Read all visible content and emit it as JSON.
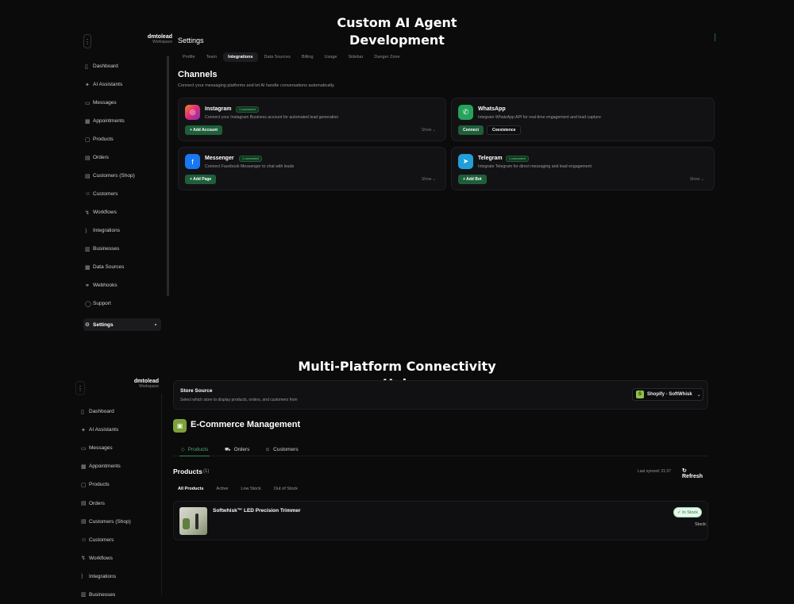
{
  "headline_top": {
    "line1": "Custom AI Agent",
    "line2": "Development"
  },
  "headline_bottom": {
    "line1": "Multi-Platform Connectivity",
    "line2": "Hub"
  },
  "panel1": {
    "workspace": {
      "name": "dmtolead",
      "sub": "Workspace"
    },
    "nav": [
      "Dashboard",
      "AI Assistants",
      "Messages",
      "Appointments",
      "Products",
      "Orders",
      "Customers (Shop)",
      "Customers",
      "Workflows",
      "Integrations",
      "Businesses",
      "Data Sources",
      "Webhooks",
      "Support"
    ],
    "active_nav": "Settings",
    "title": "Settings",
    "tabs": [
      "Profile",
      "Team",
      "Integrations",
      "Data Sources",
      "Billing",
      "Usage",
      "Sidebar",
      "Danger Zone"
    ],
    "active_tab": "Integrations",
    "channels_title": "Channels",
    "channels_desc": "Connect your messaging platforms and let AI handle conversations automatically.",
    "cards": [
      {
        "name": "Instagram",
        "badge": "1 connected",
        "desc": "Connect your Instagram Business account for automated lead generation",
        "button": "+  Add Account",
        "show": "Show ⌄",
        "color": "#d62976",
        "icon": "instagram-icon"
      },
      {
        "name": "WhatsApp",
        "badge": "",
        "desc": "Integrate WhatsApp API for real-time engagement and lead capture",
        "button": "Connect",
        "button2": "Coexistence",
        "show": "",
        "color": "#25a35a",
        "icon": "whatsapp-icon"
      },
      {
        "name": "Messenger",
        "badge": "1 connected",
        "desc": "Connect Facebook Messenger to chat with leads",
        "button": "+  Add Page",
        "show": "Show ⌄",
        "color": "#1877f2",
        "icon": "messenger-icon"
      },
      {
        "name": "Telegram",
        "badge": "1 connected",
        "desc": "Integrate Telegram for direct messaging and lead engagement",
        "button": "+  Add Bot",
        "show": "Show ⌄",
        "color": "#229ed9",
        "icon": "telegram-icon"
      }
    ]
  },
  "panel2": {
    "workspace": {
      "name": "dmtolead",
      "sub": "Workspace"
    },
    "nav": [
      "Dashboard",
      "AI Assistants",
      "Messages",
      "Appointments",
      "Products",
      "Orders",
      "Customers (Shop)",
      "Customers",
      "Workflows",
      "Integrations",
      "Businesses"
    ],
    "store_source": {
      "title": "Store Source",
      "desc": "Select which store to display products, orders, and customers from",
      "selected": "Shopify - SoftWhisk"
    },
    "ecommerce_title": "E-Commerce Management",
    "tabs": [
      "Products",
      "Orders",
      "Customers"
    ],
    "products_title": "Products",
    "products_count": "(1)",
    "last_synced": "Last synced: 21:37",
    "refresh_label": "Refresh",
    "filters": [
      "All Products",
      "Active",
      "Low Stock",
      "Out of Stock"
    ],
    "product": {
      "name": "Softwhisk™ LED Precision Trimmer",
      "status": "In Stock",
      "stock_label": "Stock:"
    }
  }
}
